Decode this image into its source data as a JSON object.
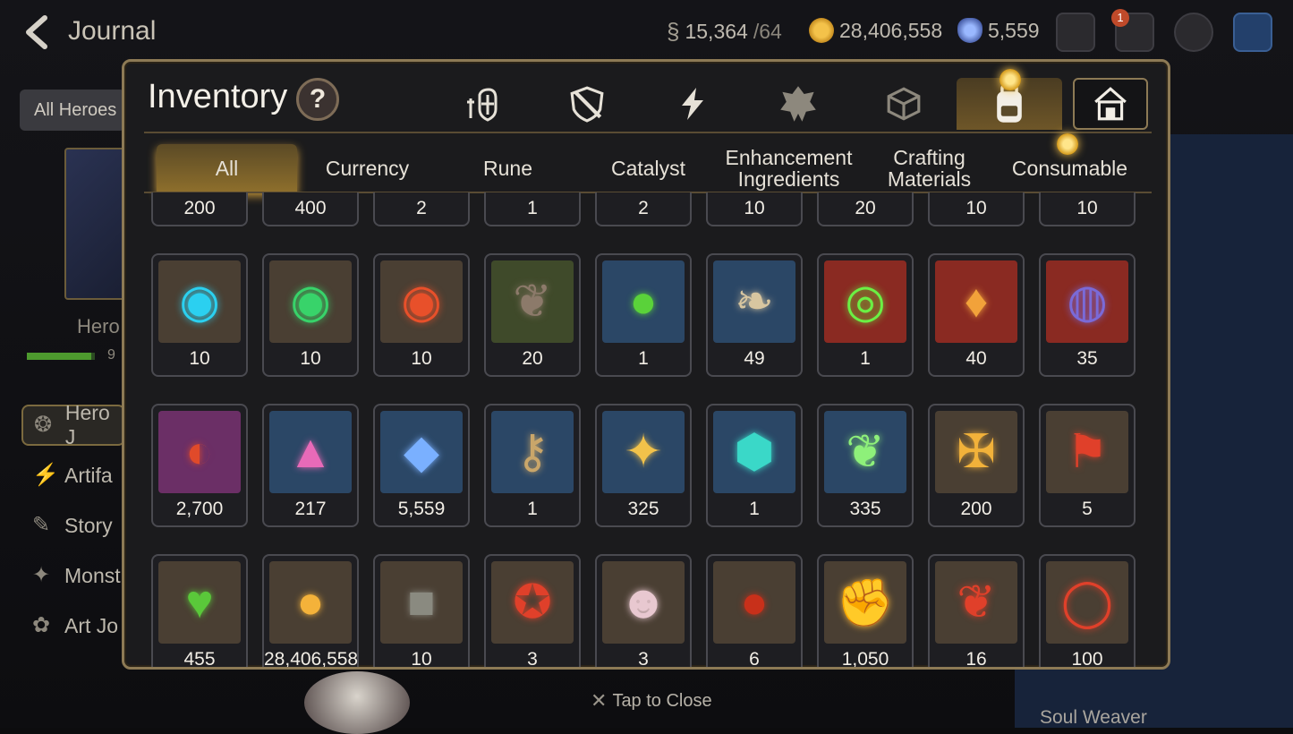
{
  "topbar": {
    "title": "Journal",
    "stamina": "15,364",
    "stamina_max": "/64",
    "gold": "28,406,558",
    "skystone": "5,559",
    "mail_badge": "1"
  },
  "side": {
    "filter": "All Heroes",
    "hero_label": "Hero",
    "hero_count": "9",
    "items": [
      {
        "label": "Hero J"
      },
      {
        "label": "Artifa"
      },
      {
        "label": "Story"
      },
      {
        "label": "Monst"
      },
      {
        "label": "Art Jo"
      }
    ]
  },
  "right_panel": {
    "label": "Soul Weaver"
  },
  "close_label": "Tap to Close",
  "modal": {
    "title": "Inventory",
    "help": "?",
    "category_tabs": [
      {
        "icon": "hero-gear-icon"
      },
      {
        "icon": "shield-icon"
      },
      {
        "icon": "lightning-icon"
      },
      {
        "icon": "crest-icon"
      },
      {
        "icon": "cube-icon"
      },
      {
        "icon": "backpack-icon",
        "active": true
      },
      {
        "icon": "storage-house-icon"
      }
    ],
    "sub_tabs": [
      {
        "label": "All",
        "active": true
      },
      {
        "label": "Currency"
      },
      {
        "label": "Rune"
      },
      {
        "label": "Catalyst"
      },
      {
        "label": "Enhancement Ingredients"
      },
      {
        "label": "Crafting Materials"
      },
      {
        "label": "Consumable"
      }
    ],
    "items": [
      {
        "qty": "200",
        "icon": "hidden-item",
        "bg": "#3b342d"
      },
      {
        "qty": "400",
        "icon": "hidden-item",
        "bg": "#3b342d"
      },
      {
        "qty": "2",
        "icon": "hidden-item",
        "bg": "#3b342d"
      },
      {
        "qty": "1",
        "icon": "hidden-item",
        "bg": "#3b342d"
      },
      {
        "qty": "2",
        "icon": "hidden-item",
        "bg": "#3b342d"
      },
      {
        "qty": "10",
        "icon": "hidden-item",
        "bg": "#3b342d"
      },
      {
        "qty": "20",
        "icon": "hidden-item",
        "bg": "#3b342d"
      },
      {
        "qty": "10",
        "icon": "hidden-item",
        "bg": "#3b342d"
      },
      {
        "qty": "10",
        "icon": "hidden-item",
        "bg": "#3b342d"
      },
      {
        "qty": "10",
        "icon": "blue-rune-icon",
        "bg": "#4a3f33"
      },
      {
        "qty": "10",
        "icon": "green-rune-icon",
        "bg": "#4a3f33"
      },
      {
        "qty": "10",
        "icon": "red-rune-icon",
        "bg": "#4a3f33"
      },
      {
        "qty": "20",
        "icon": "claw-icon",
        "bg": "#3f4a2a"
      },
      {
        "qty": "1",
        "icon": "orbs-icon",
        "bg": "#2b4766"
      },
      {
        "qty": "49",
        "icon": "root-icon",
        "bg": "#2b4766"
      },
      {
        "qty": "1",
        "icon": "green-orb-icon",
        "bg": "#8a2a22"
      },
      {
        "qty": "40",
        "icon": "amber-crystal-icon",
        "bg": "#8a2a22"
      },
      {
        "qty": "35",
        "icon": "pendant-icon",
        "bg": "#8a2a22"
      },
      {
        "qty": "2,700",
        "icon": "charm-icon",
        "bg": "#6b2f66"
      },
      {
        "qty": "217",
        "icon": "pink-mountain-icon",
        "bg": "#2b4766"
      },
      {
        "qty": "5,559",
        "icon": "blue-gem-icon",
        "bg": "#2b4766"
      },
      {
        "qty": "1",
        "icon": "key-icon",
        "bg": "#2b4766"
      },
      {
        "qty": "325",
        "icon": "star-amulet-icon",
        "bg": "#2b4766"
      },
      {
        "qty": "1",
        "icon": "teal-crystal-icon",
        "bg": "#2b4766"
      },
      {
        "qty": "335",
        "icon": "leaf-icon",
        "bg": "#2b4766"
      },
      {
        "qty": "200",
        "icon": "gold-emblem-icon",
        "bg": "#4a3f33"
      },
      {
        "qty": "5",
        "icon": "banner-icon",
        "bg": "#4a3f33"
      },
      {
        "qty": "455",
        "icon": "green-heart-icon",
        "bg": "#4a3f33"
      },
      {
        "qty": "28,406,558",
        "icon": "gold-coin-icon",
        "bg": "#4a3f33"
      },
      {
        "qty": "10",
        "icon": "stone-cube-icon",
        "bg": "#4a3f33"
      },
      {
        "qty": "3",
        "icon": "red-seal-icon",
        "bg": "#4a3f33"
      },
      {
        "qty": "3",
        "icon": "robot-icon",
        "bg": "#4a3f33"
      },
      {
        "qty": "6",
        "icon": "lava-orb-icon",
        "bg": "#4a3f33"
      },
      {
        "qty": "1,050",
        "icon": "fist-emblem-icon",
        "bg": "#4a3f33"
      },
      {
        "qty": "16",
        "icon": "red-leaf-icon",
        "bg": "#4a3f33"
      },
      {
        "qty": "100",
        "icon": "red-band-icon",
        "bg": "#4a3f33"
      }
    ]
  },
  "colors": {
    "accent_gold": "#c99a3b",
    "frame": "#8d7a55",
    "modal_bg": "#1b1b1d"
  }
}
